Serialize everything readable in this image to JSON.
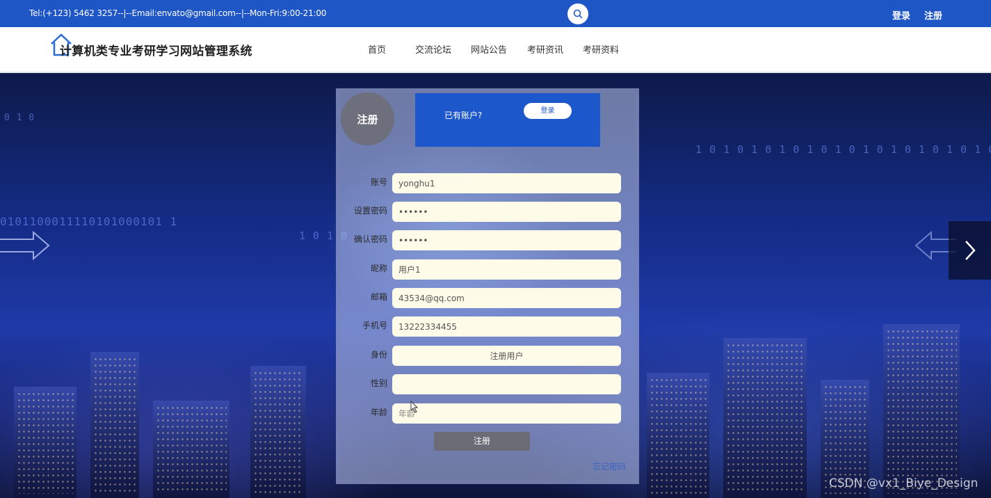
{
  "topbar": {
    "contact": "Tel:(+123) 5462 3257--|--Email:envato@gmail.com--|--Mon-Fri:9:00-21:00",
    "login": "登录",
    "register": "注册"
  },
  "header": {
    "site_title": "计算机类专业考研学习网站管理系统",
    "nav": [
      "首页",
      "交流论坛",
      "网站公告",
      "考研资讯",
      "考研资料"
    ]
  },
  "hero": {
    "binary_left": "0101100011110101000101 1",
    "binary_top_right": "1 0 1 0 1 0 1 0 1 0 1 0 1 0 1 0 1 0 1 0 1 0 1",
    "binary_mid_left": "1 0 1 0",
    "binary_small": "0 1 0"
  },
  "register": {
    "badge": "注册",
    "have_account": "已有账户?",
    "login_button": "登录",
    "fields": [
      {
        "label": "账号",
        "value": "yonghu1",
        "placeholder": ""
      },
      {
        "label": "设置密码",
        "value": "••••••",
        "placeholder": ""
      },
      {
        "label": "确认密码",
        "value": "••••••",
        "placeholder": ""
      },
      {
        "label": "昵称",
        "value": "用户1",
        "placeholder": ""
      },
      {
        "label": "邮箱",
        "value": "43534@qq.com",
        "placeholder": ""
      },
      {
        "label": "手机号",
        "value": "13222334455",
        "placeholder": ""
      },
      {
        "label": "身份",
        "value": "注册用户",
        "placeholder": ""
      },
      {
        "label": "性别",
        "value": "",
        "placeholder": ""
      },
      {
        "label": "年龄",
        "value": "",
        "placeholder": "年龄"
      }
    ],
    "submit": "注册",
    "forgot": "忘记密码"
  },
  "watermark": "CSDN @vx1_Biye_Design",
  "colors": {
    "topbar": "#1f56c6",
    "login_box": "#1d57cc",
    "input_bg": "#fefbe8",
    "badge": "#6d6f7c"
  }
}
